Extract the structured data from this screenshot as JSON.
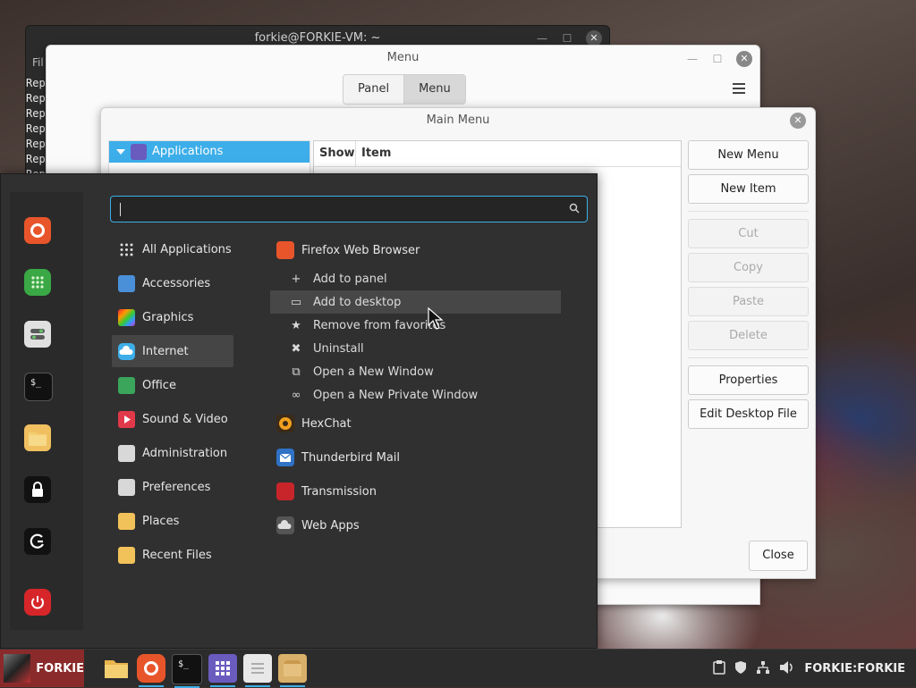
{
  "terminal": {
    "title": "forkie@FORKIE-VM: ~",
    "menu_hint": "Fil",
    "lines": [
      "Rep",
      "Rep",
      "Rep",
      "Rep",
      "Rep",
      "Rep",
      "Rep"
    ]
  },
  "menu_window": {
    "title": "Menu",
    "tabs": [
      {
        "label": "Panel"
      },
      {
        "label": "Menu"
      }
    ]
  },
  "main_menu_dialog": {
    "title": "Main Menu",
    "tree_selected": "Applications",
    "columns": [
      "Show",
      "Item"
    ],
    "buttons": {
      "new_menu": "New Menu",
      "new_item": "New Item",
      "cut": "Cut",
      "copy": "Copy",
      "paste": "Paste",
      "delete": "Delete",
      "properties": "Properties",
      "edit_desktop_file": "Edit Desktop File",
      "close": "Close"
    }
  },
  "cinnamon_menu": {
    "search": {
      "value": "",
      "placeholder": ""
    },
    "favorites": [
      "firefox-icon",
      "calculator-icon",
      "settings-icon",
      "terminal-icon",
      "files-icon",
      "lock-icon",
      "logout-icon",
      "power-icon"
    ],
    "categories": [
      {
        "label": "All Applications",
        "icon": "grid-icon",
        "color": "#303030"
      },
      {
        "label": "Accessories",
        "icon": "accessories-icon",
        "color": "#4a90d9"
      },
      {
        "label": "Graphics",
        "icon": "graphics-icon",
        "color": "#c13ad0"
      },
      {
        "label": "Internet",
        "icon": "internet-icon",
        "color": "#3daee9"
      },
      {
        "label": "Office",
        "icon": "office-icon",
        "color": "#3aa55b"
      },
      {
        "label": "Sound & Video",
        "icon": "sound-video-icon",
        "color": "#e0394a"
      },
      {
        "label": "Administration",
        "icon": "administration-icon",
        "color": "#d8d8d8"
      },
      {
        "label": "Preferences",
        "icon": "preferences-icon",
        "color": "#d8d8d8"
      },
      {
        "label": "Places",
        "icon": "folder-icon",
        "color": "#e9b44c"
      },
      {
        "label": "Recent Files",
        "icon": "recent-files-icon",
        "color": "#e9b44c"
      }
    ],
    "selected_category": "Internet",
    "apps": [
      {
        "label": "Firefox Web Browser",
        "icon": "firefox-icon"
      },
      {
        "label": "HexChat",
        "icon": "hexchat-icon"
      },
      {
        "label": "Thunderbird Mail",
        "icon": "thunderbird-icon"
      },
      {
        "label": "Transmission",
        "icon": "transmission-icon"
      },
      {
        "label": "Web Apps",
        "icon": "webapps-icon"
      }
    ],
    "context_menu": [
      {
        "label": "Add to panel",
        "glyph": "+"
      },
      {
        "label": "Add to desktop",
        "glyph": "▭"
      },
      {
        "label": "Remove from favorites",
        "glyph": "★"
      },
      {
        "label": "Uninstall",
        "glyph": "✖"
      },
      {
        "label": "Open a New Window",
        "glyph": "⧉"
      },
      {
        "label": "Open a New Private Window",
        "glyph": "∞"
      }
    ]
  },
  "panel": {
    "menu_label": "FORKIE",
    "apps": [
      "files-icon",
      "firefox-icon",
      "terminal-icon",
      "apps-grid-icon",
      "notes-icon",
      "package-icon"
    ],
    "tray_user": "FORKIE:FORKIE"
  },
  "colors": {
    "accent": "#3daee9",
    "menu_bg": "#303030",
    "panel_menu": "#8b2a2a"
  }
}
